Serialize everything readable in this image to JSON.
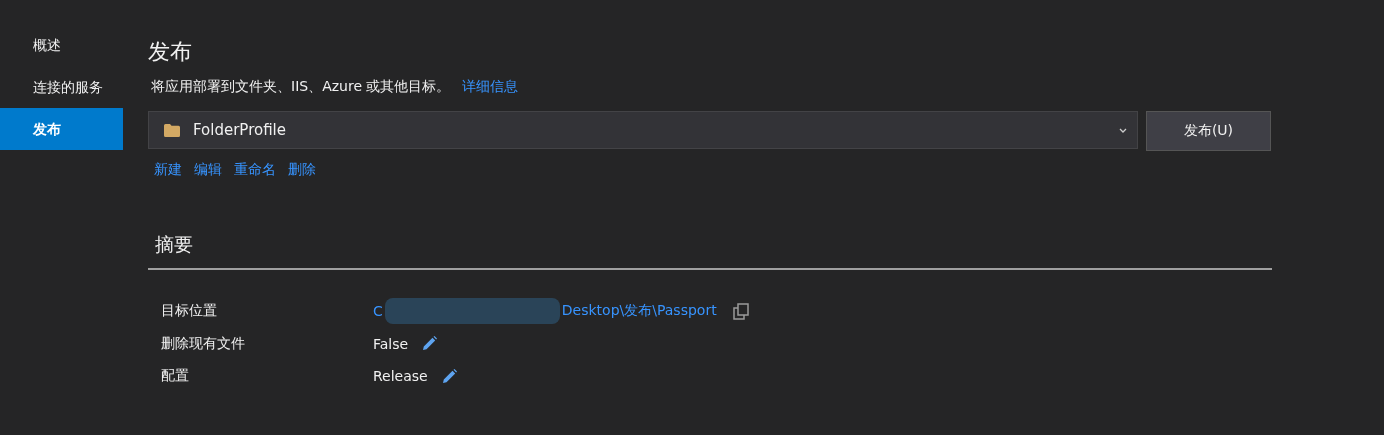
{
  "sidebar": {
    "items": [
      {
        "label": "概述",
        "selected": false
      },
      {
        "label": "连接的服务",
        "selected": false
      },
      {
        "label": "发布",
        "selected": true
      }
    ]
  },
  "page": {
    "title": "发布",
    "description": "将应用部署到文件夹、IIS、Azure 或其他目标。",
    "details_link": "详细信息"
  },
  "profile": {
    "value": "FolderProfile",
    "publish_button": "发布(U)",
    "actions": [
      "新建",
      "编辑",
      "重命名",
      "删除"
    ]
  },
  "summary": {
    "heading": "摘要",
    "rows": [
      {
        "label": "目标位置",
        "kind": "path",
        "value_start": "C",
        "value_end": "Desktop\\发布\\Passport"
      },
      {
        "label": "删除现有文件",
        "kind": "editable",
        "value": "False"
      },
      {
        "label": "配置",
        "kind": "editable",
        "value": "Release"
      }
    ]
  }
}
